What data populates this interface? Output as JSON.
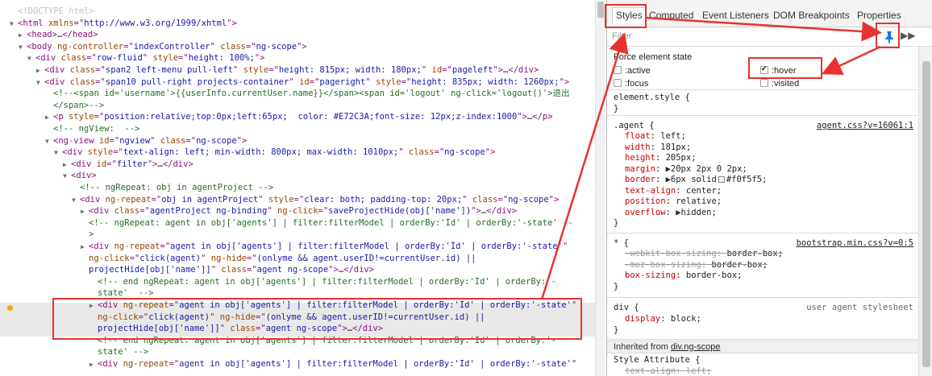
{
  "elements": {
    "lines": [
      {
        "indent": 0,
        "tri": "",
        "segs": [
          [
            "doctype",
            "<!DOCTYPE html>"
          ]
        ]
      },
      {
        "indent": 0,
        "tri": "▼",
        "segs": [
          [
            "tag",
            "<html "
          ],
          [
            "an",
            "xmlns"
          ],
          [
            "tag",
            "=\""
          ],
          [
            "av",
            "http://www.w3.org/1999/xhtml"
          ],
          [
            "tag",
            "\">"
          ]
        ]
      },
      {
        "indent": 1,
        "tri": "▶",
        "segs": [
          [
            "tag",
            "<head>"
          ],
          [
            "tx",
            "…"
          ],
          [
            "tag",
            "</head>"
          ]
        ]
      },
      {
        "indent": 1,
        "tri": "▼",
        "segs": [
          [
            "tag",
            "<body "
          ],
          [
            "an",
            "ng-controller"
          ],
          [
            "tag",
            "=\""
          ],
          [
            "av",
            "indexController"
          ],
          [
            "tag",
            "\" "
          ],
          [
            "an",
            "class"
          ],
          [
            "tag",
            "=\""
          ],
          [
            "av",
            "ng-scope"
          ],
          [
            "tag",
            "\">"
          ]
        ]
      },
      {
        "indent": 2,
        "tri": "▼",
        "segs": [
          [
            "tag",
            "<div "
          ],
          [
            "an",
            "class"
          ],
          [
            "tag",
            "=\""
          ],
          [
            "av",
            "row-fluid"
          ],
          [
            "tag",
            "\" "
          ],
          [
            "an",
            "style"
          ],
          [
            "tag",
            "=\""
          ],
          [
            "av",
            "height: 100%;"
          ],
          [
            "tag",
            "\">"
          ]
        ]
      },
      {
        "indent": 3,
        "tri": "▶",
        "segs": [
          [
            "tag",
            "<div "
          ],
          [
            "an",
            "class"
          ],
          [
            "tag",
            "=\""
          ],
          [
            "av",
            "span2 left-menu pull-left"
          ],
          [
            "tag",
            "\" "
          ],
          [
            "an",
            "style"
          ],
          [
            "tag",
            "=\""
          ],
          [
            "av",
            "height: 815px; width: 180px;"
          ],
          [
            "tag",
            "\" "
          ],
          [
            "an",
            "id"
          ],
          [
            "tag",
            "=\""
          ],
          [
            "av",
            "pageleft"
          ],
          [
            "tag",
            "\">"
          ],
          [
            "tx",
            "…"
          ],
          [
            "tag",
            "</div>"
          ]
        ]
      },
      {
        "indent": 3,
        "tri": "▼",
        "segs": [
          [
            "tag",
            "<div "
          ],
          [
            "an",
            "class"
          ],
          [
            "tag",
            "=\""
          ],
          [
            "av",
            "span10 pull-right projects-container"
          ],
          [
            "tag",
            "\" "
          ],
          [
            "an",
            "id"
          ],
          [
            "tag",
            "=\""
          ],
          [
            "av",
            "pageright"
          ],
          [
            "tag",
            "\" "
          ],
          [
            "an",
            "style"
          ],
          [
            "tag",
            "=\""
          ],
          [
            "av",
            "height: 835px; width: 1260px;"
          ],
          [
            "tag",
            "\">"
          ]
        ]
      },
      {
        "indent": 4,
        "tri": "",
        "segs": [
          [
            "cm",
            "<!--<span id='username'>{{userInfo.currentUser.name}}</span><span id='logout' ng-click='logout()'>退出"
          ]
        ]
      },
      {
        "indent": 4,
        "tri": "",
        "segs": [
          [
            "cm",
            "</span>-->"
          ]
        ]
      },
      {
        "indent": 4,
        "tri": "▶",
        "segs": [
          [
            "tag",
            "<p "
          ],
          [
            "an",
            "style"
          ],
          [
            "tag",
            "=\""
          ],
          [
            "av",
            "position:relative;top:0px;left:65px;  color: #E72C3A;font-size: 12px;z-index:1000"
          ],
          [
            "tag",
            "\">"
          ],
          [
            "tx",
            "…"
          ],
          [
            "tag",
            "</p>"
          ]
        ]
      },
      {
        "indent": 4,
        "tri": "",
        "segs": [
          [
            "cm",
            "<!-- ngView:  -->"
          ]
        ]
      },
      {
        "indent": 4,
        "tri": "▼",
        "segs": [
          [
            "tag",
            "<ng-view "
          ],
          [
            "an",
            "id"
          ],
          [
            "tag",
            "=\""
          ],
          [
            "av",
            "ngview"
          ],
          [
            "tag",
            "\" "
          ],
          [
            "an",
            "class"
          ],
          [
            "tag",
            "=\""
          ],
          [
            "av",
            "ng-scope"
          ],
          [
            "tag",
            "\">"
          ]
        ]
      },
      {
        "indent": 5,
        "tri": "▼",
        "segs": [
          [
            "tag",
            "<div "
          ],
          [
            "an",
            "style"
          ],
          [
            "tag",
            "=\""
          ],
          [
            "av",
            "text-align: left; min-width: 800px; max-width: 1010px;"
          ],
          [
            "tag",
            "\" "
          ],
          [
            "an",
            "class"
          ],
          [
            "tag",
            "=\""
          ],
          [
            "av",
            "ng-scope"
          ],
          [
            "tag",
            "\">"
          ]
        ]
      },
      {
        "indent": 6,
        "tri": "▶",
        "segs": [
          [
            "tag",
            "<div "
          ],
          [
            "an",
            "id"
          ],
          [
            "tag",
            "=\""
          ],
          [
            "av",
            "filter"
          ],
          [
            "tag",
            "\">"
          ],
          [
            "tx",
            "…"
          ],
          [
            "tag",
            "</div>"
          ]
        ]
      },
      {
        "indent": 6,
        "tri": "▼",
        "segs": [
          [
            "tag",
            "<div>"
          ]
        ]
      },
      {
        "indent": 7,
        "tri": "",
        "segs": [
          [
            "cm",
            "<!-- ngRepeat: obj in agentProject -->"
          ]
        ]
      },
      {
        "indent": 7,
        "tri": "▼",
        "segs": [
          [
            "tag",
            "<div "
          ],
          [
            "an",
            "ng-repeat"
          ],
          [
            "tag",
            "=\""
          ],
          [
            "av",
            "obj in agentProject"
          ],
          [
            "tag",
            "\" "
          ],
          [
            "an",
            "style"
          ],
          [
            "tag",
            "=\""
          ],
          [
            "av",
            "clear: both; padding-top: 20px;"
          ],
          [
            "tag",
            "\" "
          ],
          [
            "an",
            "class"
          ],
          [
            "tag",
            "=\""
          ],
          [
            "av",
            "ng-scope"
          ],
          [
            "tag",
            "\">"
          ]
        ]
      },
      {
        "indent": 8,
        "tri": "▶",
        "segs": [
          [
            "tag",
            "<div "
          ],
          [
            "an",
            "class"
          ],
          [
            "tag",
            "=\""
          ],
          [
            "av",
            "agentProject ng-binding"
          ],
          [
            "tag",
            "\" "
          ],
          [
            "an",
            "ng-click"
          ],
          [
            "tag",
            "=\""
          ],
          [
            "av",
            "saveProjectHide(obj['name'])"
          ],
          [
            "tag",
            "\">"
          ],
          [
            "tx",
            "…"
          ],
          [
            "tag",
            "</div>"
          ]
        ]
      },
      {
        "indent": 8,
        "tri": "",
        "segs": [
          [
            "cm",
            "<!-- ngRepeat: agent in obj['agents'] | filter:filterModel | orderBy:'Id' | orderBy:'-state' --"
          ]
        ]
      },
      {
        "indent": 8,
        "tri": "",
        "segs": [
          [
            "cm",
            ">"
          ]
        ]
      },
      {
        "indent": 8,
        "tri": "▶",
        "segs": [
          [
            "tag",
            "<div "
          ],
          [
            "an",
            "ng-repeat"
          ],
          [
            "tag",
            "=\""
          ],
          [
            "av",
            "agent in obj['agents'] | filter:filterModel | orderBy:'Id' | orderBy:'-state'"
          ],
          [
            "tag",
            "\""
          ]
        ]
      },
      {
        "indent": 8,
        "tri": "",
        "segs": [
          [
            "an",
            "ng-click"
          ],
          [
            "tag",
            "=\""
          ],
          [
            "av",
            "click(agent)"
          ],
          [
            "tag",
            "\" "
          ],
          [
            "an",
            "ng-hide"
          ],
          [
            "tag",
            "=\""
          ],
          [
            "av",
            "(onlyme && agent.userID!=currentUser.id) ||"
          ]
        ]
      },
      {
        "indent": 8,
        "tri": "",
        "segs": [
          [
            "av",
            "projectHide[obj['name']]"
          ],
          [
            "tag",
            "\" "
          ],
          [
            "an",
            "class"
          ],
          [
            "tag",
            "=\""
          ],
          [
            "av",
            "agent ng-scope"
          ],
          [
            "tag",
            "\">"
          ],
          [
            "tx",
            "…"
          ],
          [
            "tag",
            "</div>"
          ]
        ]
      },
      {
        "indent": 9,
        "tri": "",
        "segs": [
          [
            "cm",
            "<!-- end ngRepeat: agent in obj['agents'] | filter:filterModel | orderBy:'Id' | orderBy:'-"
          ]
        ]
      },
      {
        "indent": 9,
        "tri": "",
        "segs": [
          [
            "cm",
            "state'  -->"
          ]
        ]
      },
      {
        "indent": 9,
        "tri": "▶",
        "segs": [
          [
            "tag",
            "<div "
          ],
          [
            "an",
            "ng-repeat"
          ],
          [
            "tag",
            "=\""
          ],
          [
            "av",
            "agent in obj['agents'] | filter:filterModel | orderBy:'Id' | orderBy:'-state'"
          ],
          [
            "tag",
            "\""
          ]
        ]
      },
      {
        "indent": 9,
        "tri": "",
        "segs": [
          [
            "an",
            "ng-click"
          ],
          [
            "tag",
            "=\""
          ],
          [
            "av",
            "click(agent)"
          ],
          [
            "tag",
            "\" "
          ],
          [
            "an",
            "ng-hide"
          ],
          [
            "tag",
            "=\""
          ],
          [
            "av",
            "(onlyme && agent.userID!=currentUser.id) ||"
          ]
        ]
      },
      {
        "indent": 9,
        "tri": "",
        "segs": [
          [
            "av",
            "projectHide[obj['name']]"
          ],
          [
            "tag",
            "\" "
          ],
          [
            "an",
            "class"
          ],
          [
            "tag",
            "=\""
          ],
          [
            "av",
            "agent ng-scope"
          ],
          [
            "tag",
            "\">"
          ],
          [
            "tx",
            "…"
          ],
          [
            "tag",
            "</div>"
          ]
        ]
      },
      {
        "indent": 9,
        "tri": "",
        "segs": [
          [
            "cm",
            "<!-- end ngRepeat: agent in obj['agents'] | filter:filterModel | orderBy:'Id' | orderBy:'-"
          ]
        ]
      },
      {
        "indent": 9,
        "tri": "",
        "segs": [
          [
            "cm",
            "state' -->"
          ]
        ]
      },
      {
        "indent": 9,
        "tri": "▶",
        "segs": [
          [
            "tag",
            "<div "
          ],
          [
            "an",
            "ng-repeat"
          ],
          [
            "tag",
            "=\""
          ],
          [
            "av",
            "agent in obj['agents'] | filter:filterModel | orderBy:'Id' | orderBy:'-state'"
          ],
          [
            "tag",
            "\""
          ]
        ]
      }
    ]
  },
  "sidebar": {
    "tabs": [
      "Styles",
      "Computed",
      "Event Listeners",
      "DOM Breakpoints",
      "Properties"
    ],
    "active_tab": "Styles",
    "filter_placeholder": "Filter",
    "force_title": "Force element state",
    "states": [
      {
        "label": ":active",
        "checked": false
      },
      {
        "label": ":hover",
        "checked": true
      },
      {
        "label": ":focus",
        "checked": false
      },
      {
        "label": ":visited",
        "checked": false
      }
    ],
    "element_style": {
      "selector": "element.style {",
      "close": "}"
    },
    "agent_rule": {
      "selector": ".agent {",
      "source": "agent.css?v=16061:1",
      "props": [
        {
          "name": "float",
          "value": "left;"
        },
        {
          "name": "width",
          "value": "181px;"
        },
        {
          "name": "height",
          "value": "205px;"
        },
        {
          "name": "margin",
          "value": "▶20px 2px 0 2px;"
        },
        {
          "name": "border",
          "value": "▶6px solid",
          "swatch": "#f0f5f5",
          "tail": "#f0f5f5;"
        },
        {
          "name": "text-align",
          "value": "center;"
        },
        {
          "name": "position",
          "value": "relative;"
        },
        {
          "name": "overflow",
          "value": "▶hidden;"
        }
      ],
      "close": "}"
    },
    "star_rule": {
      "selector": "* {",
      "source": "bootstrap.min.css?v=0:5",
      "props": [
        {
          "name": "-webkit-box-sizing",
          "value": "border-box;",
          "struck": true
        },
        {
          "name": "-moz-box-sizing",
          "value": "border-box;",
          "struck": true
        },
        {
          "name": "box-sizing",
          "value": "border-box;",
          "struck": false
        }
      ],
      "close": "}"
    },
    "div_rule": {
      "selector": "div {",
      "source": "user agent stylesheet",
      "props": [
        {
          "name": "display",
          "value": "block;"
        }
      ],
      "close": "}"
    },
    "inherited_prefix": "Inherited from ",
    "inherited_link": "div.ng-scope",
    "style_attr": {
      "selector": "Style Attribute {",
      "first_prop": {
        "name": "text-align",
        "value": "left;"
      }
    }
  },
  "colors": {
    "annotation_red": "#e8322f",
    "pin_blue": "#1a73e8"
  },
  "icons": {
    "add": "plus-icon",
    "pin": "pin-icon",
    "more": "double-chevron-icon"
  }
}
